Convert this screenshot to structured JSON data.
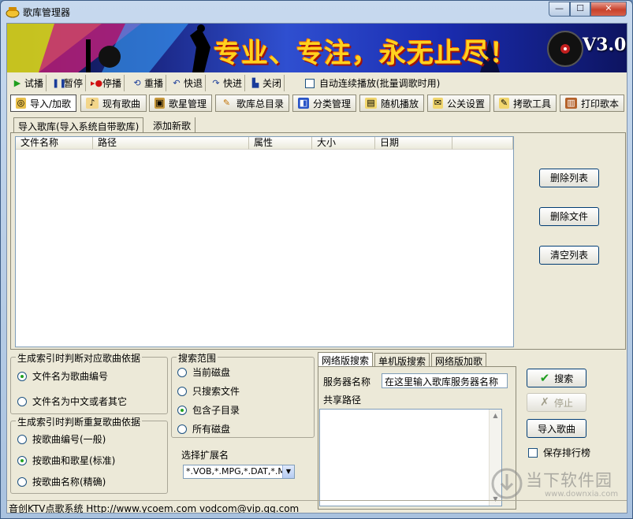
{
  "window": {
    "title": "歌库管理器",
    "controls": {
      "minimize": "—",
      "maximize": "☐",
      "close": "✕"
    }
  },
  "banner": {
    "slogan": "专业、专注，永无止尽！",
    "version": "V3.0"
  },
  "toolbar1": {
    "buttons": [
      {
        "label": "试播",
        "icon": "play-icon"
      },
      {
        "label": "暂停",
        "icon": "pause-icon"
      },
      {
        "label": "停播",
        "icon": "stop-icon"
      },
      {
        "label": "重播",
        "icon": "replay-icon"
      },
      {
        "label": "快退",
        "icon": "rewind-icon"
      },
      {
        "label": "快进",
        "icon": "forward-icon"
      },
      {
        "label": "关闭",
        "icon": "close-door-icon"
      }
    ],
    "auto_play_label": "自动连续播放(批量调歌时用)"
  },
  "main_tabs": [
    {
      "label": "导入/加歌",
      "icon": "import-icon",
      "active": true
    },
    {
      "label": "现有歌曲",
      "icon": "song-icon"
    },
    {
      "label": "歌星管理",
      "icon": "singer-icon"
    },
    {
      "label": "歌库总目录",
      "icon": "catalog-icon"
    },
    {
      "label": "分类管理",
      "icon": "category-icon"
    },
    {
      "label": "随机播放",
      "icon": "random-play-icon"
    },
    {
      "label": "公关设置",
      "icon": "settings-icon"
    },
    {
      "label": "拷歌工具",
      "icon": "copy-tool-icon"
    },
    {
      "label": "打印歌本",
      "icon": "print-icon"
    }
  ],
  "sub_tabs": [
    {
      "label": "导入歌库(导入系统自带歌库)",
      "active": true
    },
    {
      "label": "添加新歌"
    }
  ],
  "list": {
    "columns": [
      "文件名称",
      "路径",
      "属性",
      "大小",
      "日期"
    ]
  },
  "list_actions": {
    "delete_list": "删除列表",
    "delete_file": "删除文件",
    "clear_list": "清空列表"
  },
  "index_basis": {
    "title": "生成索引时判断对应歌曲依据",
    "options": [
      "文件名为歌曲编号",
      "文件名为中文或者其它"
    ],
    "selected": 0
  },
  "duplicate_basis": {
    "title": "生成索引时判断重复歌曲依据",
    "options": [
      "按歌曲编号(一般)",
      "按歌曲和歌星(标准)",
      "按歌曲名称(精确)"
    ],
    "selected": 1
  },
  "search_scope": {
    "title": "搜索范围",
    "options": [
      "当前磁盘",
      "只搜索文件",
      "包含子目录",
      "所有磁盘"
    ],
    "selected": 2
  },
  "extensions": {
    "label": "选择扩展名",
    "value": "*.VOB,*.MPG,*.DAT,*.M"
  },
  "search_tabs": [
    {
      "label": "网络版搜索",
      "active": true
    },
    {
      "label": "单机版搜索"
    },
    {
      "label": "网络版加歌"
    }
  ],
  "network_search": {
    "server_label": "服务器名称",
    "server_value": "在这里输入歌库服务器名称",
    "share_path_label": "共享路径"
  },
  "actions": {
    "search": "搜索",
    "stop": "停止",
    "import_songs": "导入歌曲",
    "save_ranking": "保存排行榜"
  },
  "statusbar": {
    "text": "音创KTV点歌系统 Http://www.ycoem.com vodcom@vip.qq.com"
  },
  "watermark": {
    "text": "当下软件园",
    "url": "www.downxia.com"
  }
}
